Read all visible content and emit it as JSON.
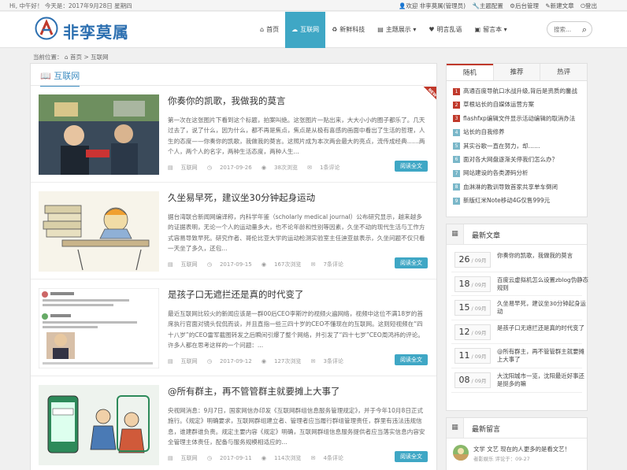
{
  "topbar": {
    "greeting": "Hi, 中午好！ 今天是：2017年9月28日 星期四",
    "links": [
      "欢迎 非孪莫属(管理员)",
      "主题配置",
      "后台管理",
      "新建文章",
      "登出"
    ]
  },
  "header": {
    "logo_text": "非孪莫属",
    "nav": [
      {
        "icon": "⌂",
        "label": "首页"
      },
      {
        "icon": "☁",
        "label": "互联网"
      },
      {
        "icon": "♻",
        "label": "新鲜科技"
      },
      {
        "icon": "▤",
        "label": "主题展示 ▾"
      },
      {
        "icon": "♥",
        "label": "明言乱语"
      },
      {
        "icon": "▣",
        "label": "留言本 ▾"
      }
    ],
    "search_placeholder": "搜索..."
  },
  "breadcrumb": {
    "label": "当前位置：",
    "home": "首页",
    "sep": ">",
    "current": "互联网"
  },
  "main": {
    "section_title": "互联网",
    "new_tag": "NEW",
    "read_more": "阅读全文",
    "posts": [
      {
        "title": "你奏你的凯歌，我做我的莫言",
        "excerpt": "第一次在这张图片下看到这个标题，拍案叫绝。这张图片一贴出来，大大小小的圈子都乐了。几天过去了，说了什么，因为什么，都不再是焦点，焦点是从极有喜感的画面中看出了生活的哲理，人生的态度——你奏你的凯歌，我做我的莫言。这照片成为本次两会最大的亮点，流传成经典……两个人，两个人的名字，两种生活态度，两种人生...",
        "category": "互联网",
        "date": "2017-09-26",
        "views": "38次浏览",
        "comments": "1条评论"
      },
      {
        "title": "久坐易早死，建议坐30分钟起身运动",
        "excerpt": "据台湾联合新闻网编译称，内科学年鉴（scholarly medical journal）公布研究显示，越来越多的证据表明，无论一个人的运动量多大，也不论年龄和性别等因素，久坐不动的现代生活与工作方式容易导致早死。研究作者、哥伦比亚大学的运动检测实验室主任迪亚兹表示，久坐问题不仅只看一天坐了多久，还包...",
        "category": "互联网",
        "date": "2017-09-15",
        "views": "167次浏览",
        "comments": "7条评论"
      },
      {
        "title": "是孩子口无遮拦还是真的时代变了",
        "excerpt": "最近互联网比较火的新闻应该是一群00后CEO李斯咛的视频火遍网络，视频中这位不满18岁的首席执行官面对镜头侃侃而谈，并且直指一些三四十岁的CEO不懂现在的互联网。这则短视频在“四十八岁”的CEO雷军截图转发之后瞬间引爆了整个网络，并引发了“四十七岁”CEO周鸿祎的评论。许多人都在思考这样的一个问题：...",
        "category": "互联网",
        "date": "2017-09-12",
        "views": "127次浏览",
        "comments": "3条评论"
      },
      {
        "title": "@所有群主，再不管管群主就要摊上大事了",
        "excerpt": "央视网消息：9月7日，国家网信办印发《互联网群组信息服务管理规定》，并于今年10月8日正式施行。《规定》明确要求，互联网群组建立者、管理者应当履行群组管理责任，群里有违法违规信息，谁建群谁负责。规定主要内容《规定》明确，互联网群组信息服务提供者应当落实信息内容安全管理主体责任，配备与服务规模相适应的...",
        "category": "互联网",
        "date": "2017-09-11",
        "views": "114次浏览",
        "comments": "4条评论"
      }
    ]
  },
  "sidebar": {
    "tabs": [
      "随机",
      "推荐",
      "热评"
    ],
    "random_list": [
      "高通百度导航口水战升级,背后是资质的鏖战",
      "草根站长的自媒体运营方案",
      "flashfxp编辑文件显示活动编辑的取消办法",
      "站长的自我修养",
      "其实谷歌一直在努力，却……",
      "面对各大网盘逐渐关停我们怎么办？",
      "网站建设的各类源码分析",
      "血淋淋的教训导致首家共享单车倒闭",
      "新版红米Note移动4G仅售999元"
    ],
    "latest_title": "最新文章",
    "latest": [
      {
        "day": "26",
        "month": "/ 09月",
        "title": "你奏你的凯歌，我做我的莫言"
      },
      {
        "day": "18",
        "month": "/ 09月",
        "title": "百度云虚拟机怎么设置zblog伪静态规则"
      },
      {
        "day": "15",
        "month": "/ 09月",
        "title": "久坐易早死，建议坐30分钟起身运动"
      },
      {
        "day": "12",
        "month": "/ 09月",
        "title": "是孩子口无遮拦还是真的时代变了"
      },
      {
        "day": "11",
        "month": "/ 09月",
        "title": "@所有群主，再不管管群主就要摊上大事了"
      },
      {
        "day": "08",
        "month": "/ 09月",
        "title": "大沈阳城市一览，沈阳最近好事还是挺多的嘛"
      }
    ],
    "comments_title": "最新留言",
    "comment": {
      "text": "文学 文艺 现在的人更多的是看文艺！",
      "meta": "者影娱乐 评论于：09-27"
    }
  }
}
